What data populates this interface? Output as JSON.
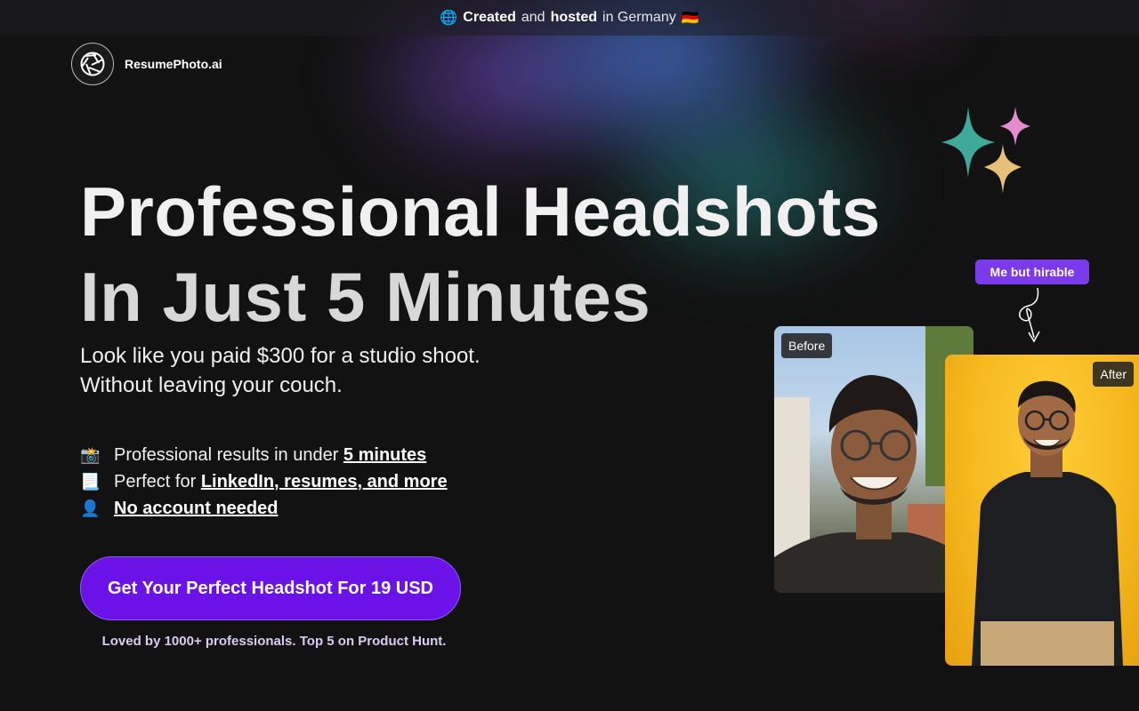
{
  "topbar": {
    "globe": "🌐",
    "created": "Created",
    "and": "and",
    "hosted": "hosted",
    "in_germany": "in Germany",
    "flag": "🇩🇪"
  },
  "brand": {
    "name": "ResumePhoto.ai",
    "icon": "aperture-icon"
  },
  "hero": {
    "headline_line1": "Professional Headshots",
    "headline_line2": "In Just 5 Minutes",
    "sub_line1": "Look like you paid $300 for a studio shoot.",
    "sub_line2": "Without leaving your couch."
  },
  "features": [
    {
      "icon": "📸",
      "text": "Professional results in under ",
      "highlight": "5 minutes"
    },
    {
      "icon": "📃",
      "text": "Perfect for ",
      "highlight": "LinkedIn, resumes, and more"
    },
    {
      "icon": "👤",
      "text": "",
      "highlight": "No account needed"
    }
  ],
  "cta": {
    "label": "Get Your Perfect Headshot For 19 USD",
    "social_proof": "Loved by 1000+ professionals. Top 5 on Product Hunt."
  },
  "showcase": {
    "tag": "Me but hirable",
    "before_label": "Before",
    "after_label": "After"
  },
  "colors": {
    "accent": "#6a12e8",
    "tag": "#7c3aed",
    "background": "#121212",
    "after_bg": "#f6b81e"
  }
}
